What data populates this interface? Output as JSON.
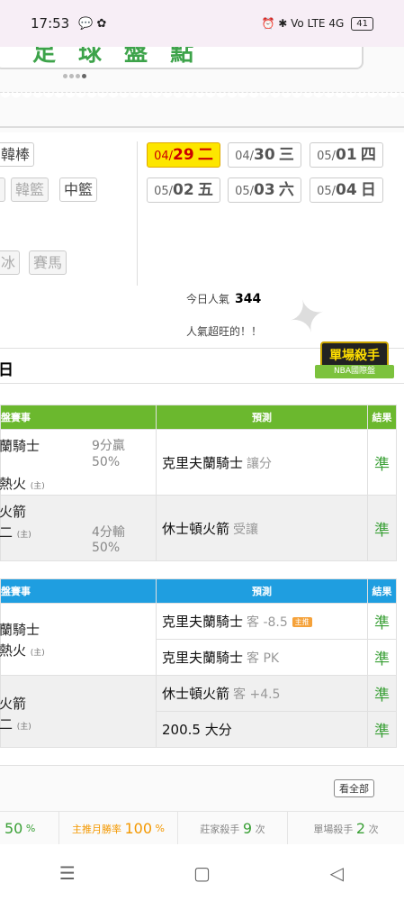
{
  "status": {
    "time": "17:53",
    "left_icons": "💬 ✿",
    "right_icons": "⏰ ✱ Vo LTE 4G",
    "battery": "41"
  },
  "banner": {
    "title": "足 球 盤 點"
  },
  "filters": {
    "row1": [
      "韓棒"
    ],
    "row2": [
      "",
      "韓籃",
      "中籃"
    ],
    "row3": [
      "冰",
      "賽馬"
    ]
  },
  "dates": [
    {
      "md": "04/",
      "d": "29",
      "wd": "二"
    },
    {
      "md": "04/",
      "d": "30",
      "wd": "三"
    },
    {
      "md": "05/",
      "d": "01",
      "wd": "四"
    },
    {
      "md": "05/",
      "d": "02",
      "wd": "五"
    },
    {
      "md": "05/",
      "d": "03",
      "wd": "六"
    },
    {
      "md": "05/",
      "d": "04",
      "wd": "日"
    }
  ],
  "popularity": {
    "label": "今日人氣",
    "count": "344",
    "note": "人氣超旺的！！"
  },
  "section": {
    "day": "日",
    "badge_main": "單場殺手",
    "badge_sub": "NBA國際盤"
  },
  "table1": {
    "headers": [
      "盤賽事",
      "預測",
      "結果"
    ],
    "rows": [
      {
        "team_a": "蘭騎士",
        "team_b": "熱火",
        "mark_b": "(主)",
        "rate": "9分贏",
        "pct": "50%",
        "pick": "克里夫蘭騎士",
        "pick_sub": "讓分",
        "result": "準"
      },
      {
        "team_a": "火箭",
        "team_b": "二",
        "mark_b": "(主)",
        "rate": "4分輸",
        "pct": "50%",
        "pick": "休士頓火箭",
        "pick_sub": "受讓",
        "result": "準"
      }
    ]
  },
  "table2": {
    "headers": [
      "盤賽事",
      "預測",
      "結果"
    ],
    "game1": {
      "team_a": "蘭騎士",
      "team_b": "熱火",
      "mark_b": "(主)"
    },
    "game2": {
      "team_a": "火箭",
      "team_b": "二",
      "mark_b": "(主)"
    },
    "picks": [
      {
        "pick": "克里夫蘭騎士",
        "sub": "客 -8.5",
        "tag": "主推",
        "result": "準"
      },
      {
        "pick": "克里夫蘭騎士",
        "sub": "客 PK",
        "tag": "",
        "result": "準"
      },
      {
        "pick": "休士頓火箭",
        "sub": "客 +4.5",
        "tag": "",
        "result": "準"
      },
      {
        "pick": "200.5 大分",
        "sub": "",
        "tag": "",
        "result": "準"
      }
    ]
  },
  "stats": {
    "see_all": "看全部",
    "first_num": "50",
    "first_unit": "%",
    "monthly_label": "主推月勝率",
    "monthly_num": "100",
    "monthly_unit": "%",
    "banker_label": "莊家殺手",
    "banker_num": "9",
    "banker_unit": "次",
    "single_label": "單場殺手",
    "single_num": "2",
    "single_unit": "次"
  },
  "nav": {
    "menu": "☰",
    "home": "▢",
    "back": "◁"
  }
}
